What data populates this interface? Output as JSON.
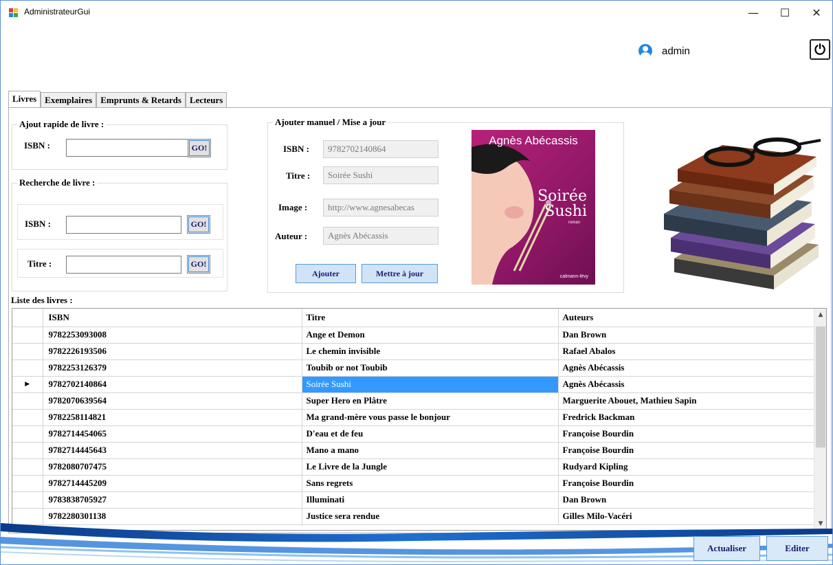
{
  "window": {
    "title": "AdministrateurGui",
    "minimize_glyph": "—",
    "maximize_glyph": "☐",
    "close_glyph": "✕"
  },
  "user": {
    "name": "admin",
    "icon": "user-circle-icon"
  },
  "power": {
    "glyph": "⏻",
    "icon": "power-icon"
  },
  "tabs": [
    {
      "label": "Livres",
      "active": true
    },
    {
      "label": "Exemplaires",
      "active": false
    },
    {
      "label": "Emprunts & Retards",
      "active": false
    },
    {
      "label": "Lecteurs",
      "active": false
    }
  ],
  "quick_add": {
    "title": "Ajout rapide de livre :",
    "isbn_label": "ISBN :",
    "isbn_value": "",
    "go": "GO!"
  },
  "search": {
    "title": "Recherche de livre :",
    "isbn_label": "ISBN :",
    "isbn_value": "",
    "isbn_go": "GO!",
    "titre_label": "Titre :",
    "titre_value": "",
    "titre_go": "GO!"
  },
  "manual": {
    "title": "Ajouter manuel / Mise a jour",
    "isbn_label": "ISBN :",
    "isbn_value": "9782702140864",
    "titre_label": "Titre :",
    "titre_value": "Soirée Sushi",
    "image_label": "Image :",
    "image_value": "http://www.agnesabecas",
    "auteur_label": "Auteur :",
    "auteur_value": "Agnès Abécassis",
    "add_button": "Ajouter",
    "update_button": "Mettre à jour"
  },
  "cover": {
    "author": "Agnès Abécassis",
    "title_line1": "Soirée",
    "title_line2": "Sushi",
    "subtitle": "roman",
    "publisher": "calmann-lévy"
  },
  "list": {
    "label": "Liste des livres :",
    "columns": [
      "ISBN",
      "Titre",
      "Auteurs"
    ],
    "selected_index": 3,
    "rows": [
      {
        "isbn": "9782253093008",
        "titre": "Ange et Demon",
        "auteurs": "Dan Brown"
      },
      {
        "isbn": "9782226193506",
        "titre": "Le chemin invisible",
        "auteurs": "Rafael Abalos"
      },
      {
        "isbn": "9782253126379",
        "titre": "Toubib or not Toubib",
        "auteurs": "Agnès Abécassis"
      },
      {
        "isbn": "9782702140864",
        "titre": "Soirée Sushi",
        "auteurs": "Agnès Abécassis"
      },
      {
        "isbn": "9782070639564",
        "titre": "Super Hero en Plâtre",
        "auteurs": "Marguerite Abouet,  Mathieu Sapin"
      },
      {
        "isbn": "9782258114821",
        "titre": "Ma grand-mère vous passe le bonjour",
        "auteurs": "Fredrick Backman"
      },
      {
        "isbn": "9782714454065",
        "titre": "D'eau et de feu",
        "auteurs": "Françoise Bourdin"
      },
      {
        "isbn": "9782714445643",
        "titre": "Mano a mano",
        "auteurs": "Françoise Bourdin"
      },
      {
        "isbn": "9782080707475",
        "titre": "Le Livre de la Jungle",
        "auteurs": "Rudyard Kipling"
      },
      {
        "isbn": "9782714445209",
        "titre": "Sans regrets",
        "auteurs": "Françoise Bourdin"
      },
      {
        "isbn": "9783838705927",
        "titre": "Illuminati",
        "auteurs": "Dan Brown"
      },
      {
        "isbn": "9782280301138",
        "titre": "Justice sera rendue",
        "auteurs": "Gilles Milo-Vacéri"
      }
    ]
  },
  "footer": {
    "refresh_button": "Actualiser",
    "edit_button": "Editer"
  },
  "colors": {
    "selection": "#3399ff",
    "button_border": "#5c9ad8",
    "cover_bg": "#a51c72"
  }
}
